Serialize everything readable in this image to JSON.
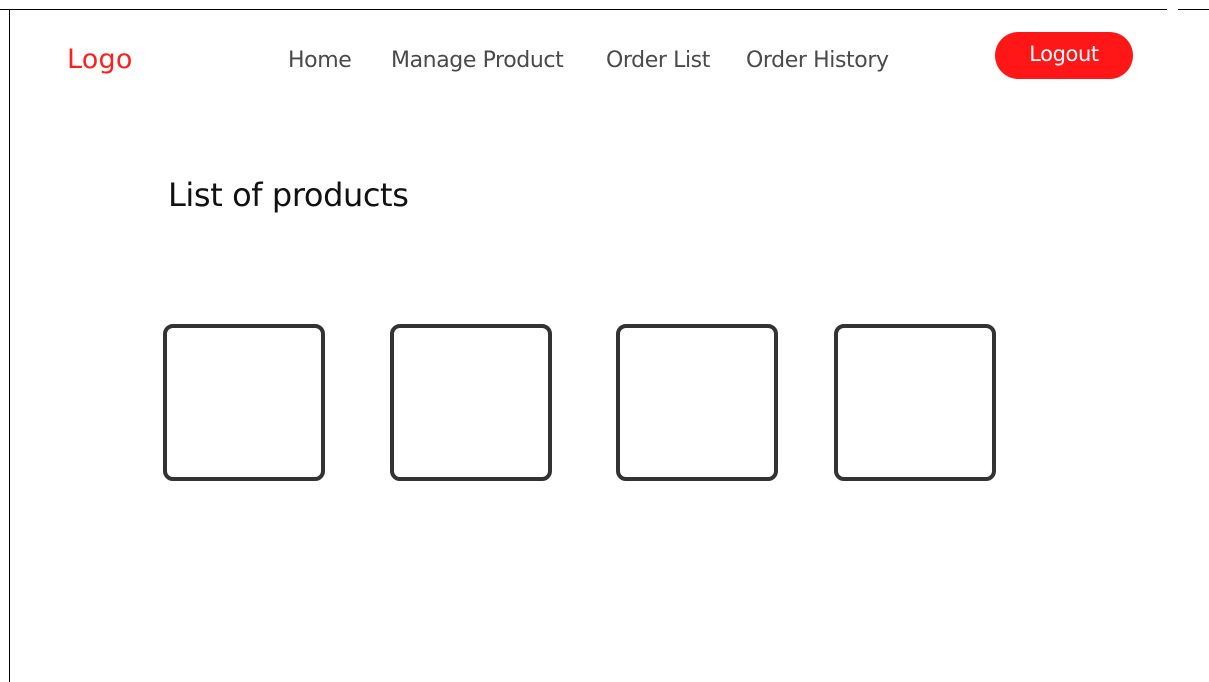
{
  "header": {
    "logo": "Logo",
    "nav": {
      "home": "Home",
      "manage_product": "Manage Product",
      "order_list": "Order List",
      "order_history": "Order History"
    },
    "logout_label": "Logout"
  },
  "main": {
    "title": "List of products",
    "products": [
      {
        "id": 1
      },
      {
        "id": 2
      },
      {
        "id": 3
      },
      {
        "id": 4
      }
    ]
  },
  "colors": {
    "accent": "#ff1616",
    "nav_text": "#4a4a4a",
    "card_border": "#333333"
  }
}
